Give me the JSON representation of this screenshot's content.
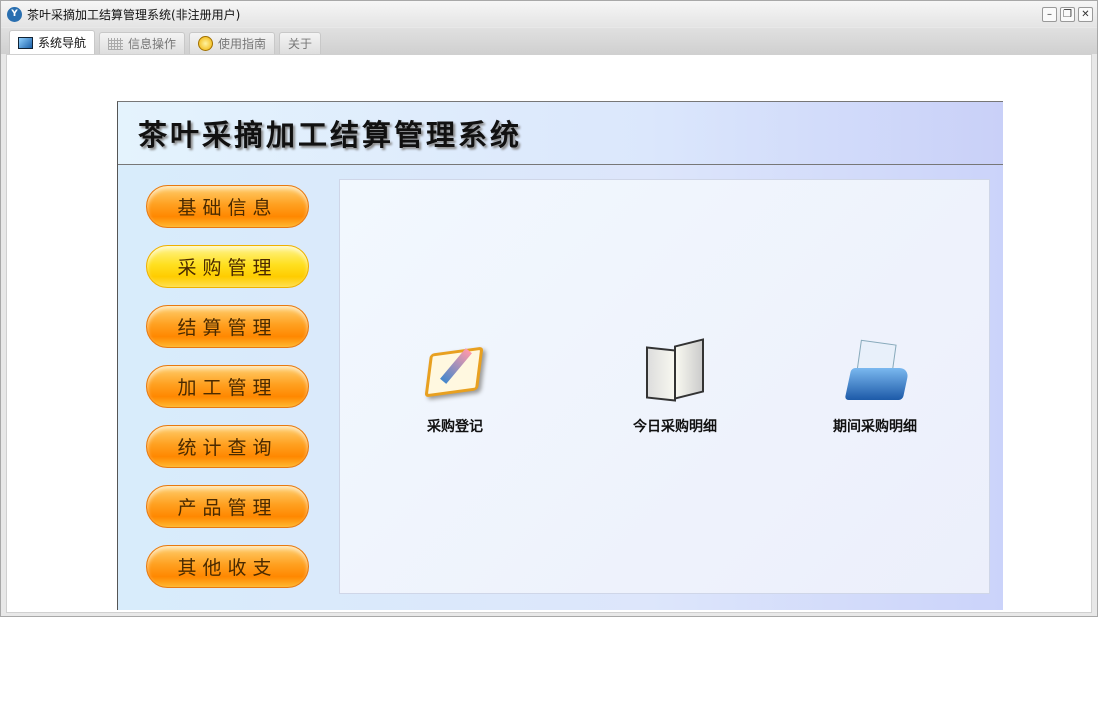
{
  "window": {
    "title": "茶叶采摘加工结算管理系统(非注册用户)",
    "controls": [
      "minimize",
      "restore",
      "close"
    ]
  },
  "tabs": [
    {
      "label": "系统导航",
      "icon": "monitor-icon",
      "active": true
    },
    {
      "label": "信息操作",
      "icon": "grid-icon"
    },
    {
      "label": "使用指南",
      "icon": "help-icon"
    },
    {
      "label": "关于"
    }
  ],
  "header": {
    "title": "茶叶采摘加工结算管理系统"
  },
  "menu": [
    {
      "label": "基础信息"
    },
    {
      "label": "采购管理",
      "selected": true
    },
    {
      "label": "结算管理"
    },
    {
      "label": "加工管理"
    },
    {
      "label": "统计查询"
    },
    {
      "label": "产品管理"
    },
    {
      "label": "其他收支"
    }
  ],
  "functions": [
    {
      "label": "采购登记",
      "icon": "clipboard-pen-icon"
    },
    {
      "label": "今日采购明细",
      "icon": "notebook-icon"
    },
    {
      "label": "期间采购明细",
      "icon": "folder-documents-icon"
    }
  ]
}
